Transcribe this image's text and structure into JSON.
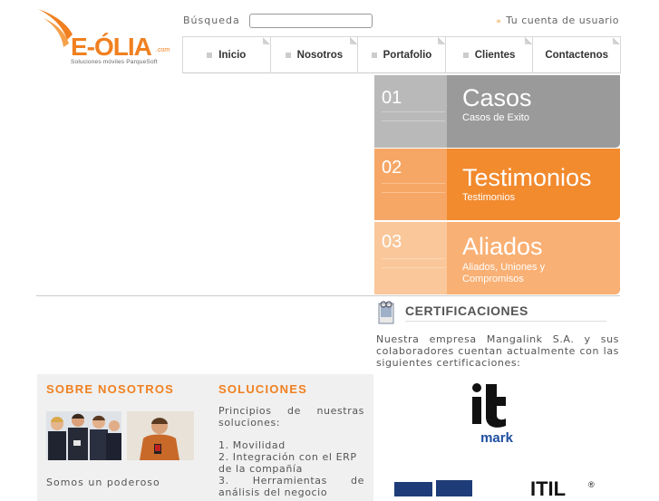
{
  "logo": {
    "name": "E-ÓLIA",
    "com": ".com",
    "tagline": "Soluciones móviles  ParqueSoft"
  },
  "header": {
    "search_label": "Búsqueda",
    "search_value": "",
    "account_link": "Tu cuenta de usuario"
  },
  "nav": [
    "Inicio",
    "Nosotros",
    "Portafolio",
    "Clientes",
    "Contactenos"
  ],
  "slider": [
    {
      "num": "01",
      "title": "Casos",
      "subtitle": "Casos de Exito"
    },
    {
      "num": "02",
      "title": "Testimonios",
      "subtitle": "Testimonios"
    },
    {
      "num": "03",
      "title": "Aliados",
      "subtitle": "Aliados, Uniones y Compromisos"
    }
  ],
  "certificaciones": {
    "title": "CERTIFICACIONES",
    "text": "Nuestra empresa Mangalink S.A. y sus colaboradores cuentan actualmente con las siguientes certificaciones:",
    "logo1": "it mark",
    "logo2": "ITIL"
  },
  "sobre": {
    "title": "SOBRE NOSOTROS",
    "text": "Somos un poderoso"
  },
  "soluciones": {
    "title": "SOLUCIONES",
    "intro": "Principios de nuestras soluciones:",
    "items": [
      "1. Movilidad",
      "2. Integración con el ERP de la compañía",
      "3. Herramientas de análisis del negocio"
    ]
  },
  "colors": {
    "orange": "#f08020",
    "gray_panel": "#9a9a9a",
    "orange_panel": "#f28a2e",
    "light_orange_panel": "#f9b074"
  }
}
